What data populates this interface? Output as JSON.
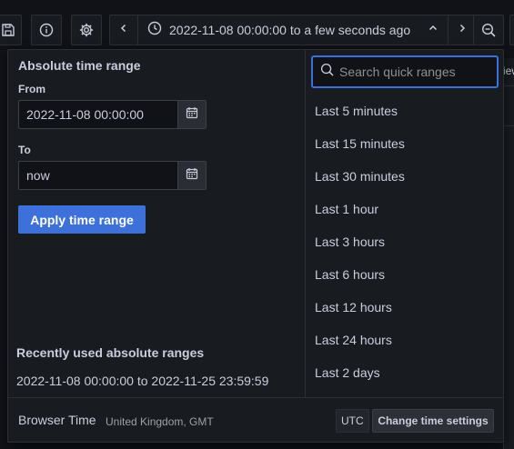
{
  "toolbar": {
    "time_range_label": "2022-11-08 00:00:00 to a few seconds ago"
  },
  "background": {
    "view_label": "iew"
  },
  "popup": {
    "absolute": {
      "heading": "Absolute time range",
      "from_label": "From",
      "from_value": "2022-11-08 00:00:00",
      "to_label": "To",
      "to_value": "now",
      "apply_label": "Apply time range"
    },
    "recent": {
      "heading": "Recently used absolute ranges",
      "items": [
        "2022-11-08 00:00:00 to 2022-11-25 23:59:59"
      ]
    },
    "search": {
      "placeholder": "Search quick ranges"
    },
    "quick_ranges": [
      "Last 5 minutes",
      "Last 15 minutes",
      "Last 30 minutes",
      "Last 1 hour",
      "Last 3 hours",
      "Last 6 hours",
      "Last 12 hours",
      "Last 24 hours",
      "Last 2 days"
    ],
    "footer": {
      "title": "Browser Time",
      "zone": "United Kingdom, GMT",
      "utc_badge": "UTC",
      "change_label": "Change time settings"
    }
  },
  "colors": {
    "accent": "#3d71d9",
    "background": "#111217",
    "panel": "#181b1f",
    "text": "#ccccdc"
  },
  "icons": [
    "save-icon",
    "info-icon",
    "gear-icon",
    "chevron-left-icon",
    "clock-icon",
    "chevron-up-icon",
    "chevron-right-icon",
    "zoom-out-icon",
    "calendar-icon",
    "search-icon"
  ]
}
